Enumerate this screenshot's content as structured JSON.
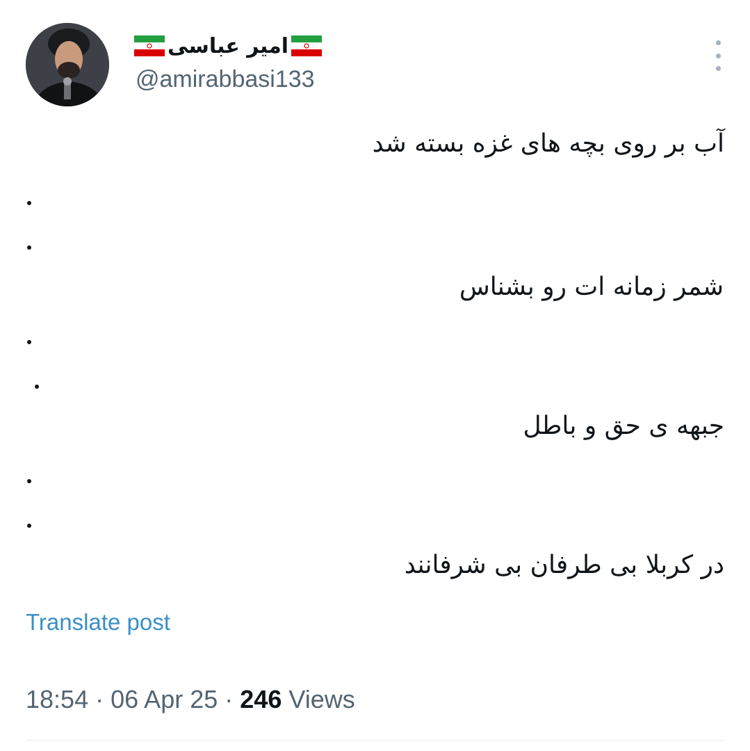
{
  "author": {
    "display_name": "امیر عباسی",
    "handle": "@amirabbasi133",
    "flag_colors": {
      "green": "#239f40",
      "white": "#ffffff",
      "red": "#da0000"
    }
  },
  "tweet": {
    "lines": [
      "آب بر روی بچه های غزه بسته شد",
      ".",
      ".",
      "شمر زمانه ات رو بشناس",
      ".",
      ".",
      "جبهه ی حق و باطل",
      ".",
      ".",
      "در کربلا بی طرفان بی شرفانند"
    ]
  },
  "translate_label": "Translate post",
  "meta": {
    "time": "18:54",
    "separator": "·",
    "date": "06 Apr 25",
    "views_count": "246",
    "views_label": "Views"
  },
  "colors": {
    "text": "#0f1419",
    "secondary": "#536471",
    "link": "#3a8fc8"
  },
  "icons": {
    "more": "more-vertical-icon",
    "flag": "iran-flag-icon"
  }
}
